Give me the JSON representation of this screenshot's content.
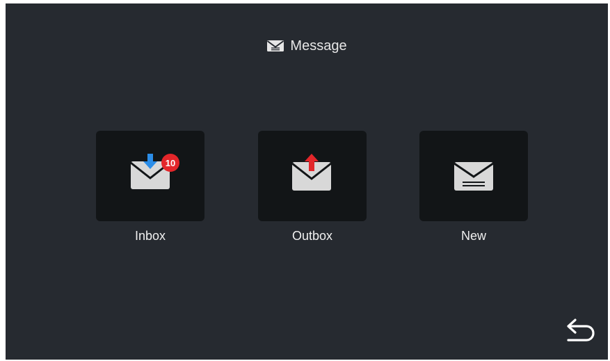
{
  "header": {
    "title": "Message",
    "icon": "envelope-icon"
  },
  "tiles": [
    {
      "label": "Inbox",
      "icon": "inbox-envelope-icon",
      "badge": "10"
    },
    {
      "label": "Outbox",
      "icon": "outbox-envelope-icon"
    },
    {
      "label": "New",
      "icon": "new-message-envelope-icon"
    }
  ],
  "footer": {
    "back_icon": "back-arrow-icon"
  },
  "colors": {
    "background": "#262a30",
    "tile": "#121517",
    "envelope": "#d8d8d8",
    "badge": "#e3262a",
    "inbox_arrow": "#2b8de8",
    "outbox_arrow": "#e3262a",
    "text": "#f0f0f0"
  }
}
